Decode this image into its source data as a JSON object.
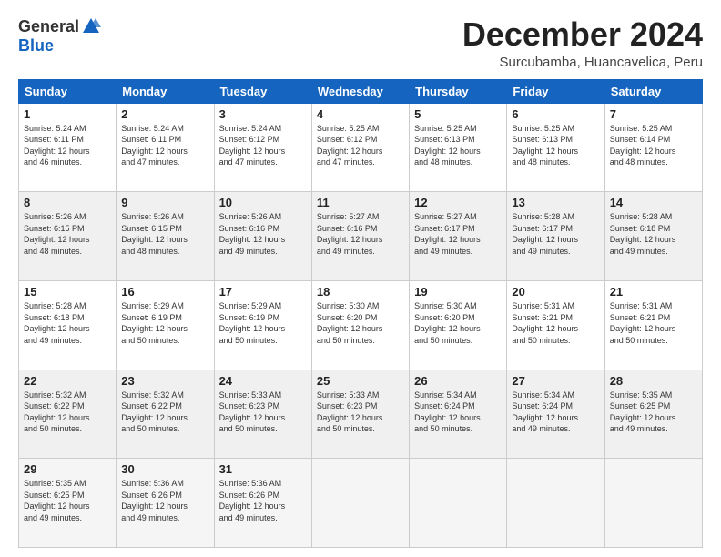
{
  "header": {
    "logo_general": "General",
    "logo_blue": "Blue",
    "title": "December 2024",
    "subtitle": "Surcubamba, Huancavelica, Peru"
  },
  "calendar": {
    "days_of_week": [
      "Sunday",
      "Monday",
      "Tuesday",
      "Wednesday",
      "Thursday",
      "Friday",
      "Saturday"
    ],
    "weeks": [
      [
        {
          "day": "",
          "info": ""
        },
        {
          "day": "2",
          "info": "Sunrise: 5:24 AM\nSunset: 6:11 PM\nDaylight: 12 hours\nand 47 minutes."
        },
        {
          "day": "3",
          "info": "Sunrise: 5:24 AM\nSunset: 6:12 PM\nDaylight: 12 hours\nand 47 minutes."
        },
        {
          "day": "4",
          "info": "Sunrise: 5:25 AM\nSunset: 6:12 PM\nDaylight: 12 hours\nand 47 minutes."
        },
        {
          "day": "5",
          "info": "Sunrise: 5:25 AM\nSunset: 6:13 PM\nDaylight: 12 hours\nand 48 minutes."
        },
        {
          "day": "6",
          "info": "Sunrise: 5:25 AM\nSunset: 6:13 PM\nDaylight: 12 hours\nand 48 minutes."
        },
        {
          "day": "7",
          "info": "Sunrise: 5:25 AM\nSunset: 6:14 PM\nDaylight: 12 hours\nand 48 minutes."
        }
      ],
      [
        {
          "day": "1",
          "info": "Sunrise: 5:24 AM\nSunset: 6:11 PM\nDaylight: 12 hours\nand 46 minutes."
        },
        {
          "day": "9",
          "info": "Sunrise: 5:26 AM\nSunset: 6:15 PM\nDaylight: 12 hours\nand 48 minutes."
        },
        {
          "day": "10",
          "info": "Sunrise: 5:26 AM\nSunset: 6:16 PM\nDaylight: 12 hours\nand 49 minutes."
        },
        {
          "day": "11",
          "info": "Sunrise: 5:27 AM\nSunset: 6:16 PM\nDaylight: 12 hours\nand 49 minutes."
        },
        {
          "day": "12",
          "info": "Sunrise: 5:27 AM\nSunset: 6:17 PM\nDaylight: 12 hours\nand 49 minutes."
        },
        {
          "day": "13",
          "info": "Sunrise: 5:28 AM\nSunset: 6:17 PM\nDaylight: 12 hours\nand 49 minutes."
        },
        {
          "day": "14",
          "info": "Sunrise: 5:28 AM\nSunset: 6:18 PM\nDaylight: 12 hours\nand 49 minutes."
        }
      ],
      [
        {
          "day": "8",
          "info": "Sunrise: 5:26 AM\nSunset: 6:15 PM\nDaylight: 12 hours\nand 48 minutes."
        },
        {
          "day": "16",
          "info": "Sunrise: 5:29 AM\nSunset: 6:19 PM\nDaylight: 12 hours\nand 50 minutes."
        },
        {
          "day": "17",
          "info": "Sunrise: 5:29 AM\nSunset: 6:19 PM\nDaylight: 12 hours\nand 50 minutes."
        },
        {
          "day": "18",
          "info": "Sunrise: 5:30 AM\nSunset: 6:20 PM\nDaylight: 12 hours\nand 50 minutes."
        },
        {
          "day": "19",
          "info": "Sunrise: 5:30 AM\nSunset: 6:20 PM\nDaylight: 12 hours\nand 50 minutes."
        },
        {
          "day": "20",
          "info": "Sunrise: 5:31 AM\nSunset: 6:21 PM\nDaylight: 12 hours\nand 50 minutes."
        },
        {
          "day": "21",
          "info": "Sunrise: 5:31 AM\nSunset: 6:21 PM\nDaylight: 12 hours\nand 50 minutes."
        }
      ],
      [
        {
          "day": "15",
          "info": "Sunrise: 5:28 AM\nSunset: 6:18 PM\nDaylight: 12 hours\nand 49 minutes."
        },
        {
          "day": "23",
          "info": "Sunrise: 5:32 AM\nSunset: 6:22 PM\nDaylight: 12 hours\nand 50 minutes."
        },
        {
          "day": "24",
          "info": "Sunrise: 5:33 AM\nSunset: 6:23 PM\nDaylight: 12 hours\nand 50 minutes."
        },
        {
          "day": "25",
          "info": "Sunrise: 5:33 AM\nSunset: 6:23 PM\nDaylight: 12 hours\nand 50 minutes."
        },
        {
          "day": "26",
          "info": "Sunrise: 5:34 AM\nSunset: 6:24 PM\nDaylight: 12 hours\nand 50 minutes."
        },
        {
          "day": "27",
          "info": "Sunrise: 5:34 AM\nSunset: 6:24 PM\nDaylight: 12 hours\nand 49 minutes."
        },
        {
          "day": "28",
          "info": "Sunrise: 5:35 AM\nSunset: 6:25 PM\nDaylight: 12 hours\nand 49 minutes."
        }
      ],
      [
        {
          "day": "22",
          "info": "Sunrise: 5:32 AM\nSunset: 6:22 PM\nDaylight: 12 hours\nand 50 minutes."
        },
        {
          "day": "30",
          "info": "Sunrise: 5:36 AM\nSunset: 6:26 PM\nDaylight: 12 hours\nand 49 minutes."
        },
        {
          "day": "31",
          "info": "Sunrise: 5:36 AM\nSunset: 6:26 PM\nDaylight: 12 hours\nand 49 minutes."
        },
        {
          "day": "",
          "info": ""
        },
        {
          "day": "",
          "info": ""
        },
        {
          "day": "",
          "info": ""
        },
        {
          "day": ""
        }
      ]
    ],
    "week5_sunday": {
      "day": "29",
      "info": "Sunrise: 5:35 AM\nSunset: 6:25 PM\nDaylight: 12 hours\nand 49 minutes."
    }
  }
}
